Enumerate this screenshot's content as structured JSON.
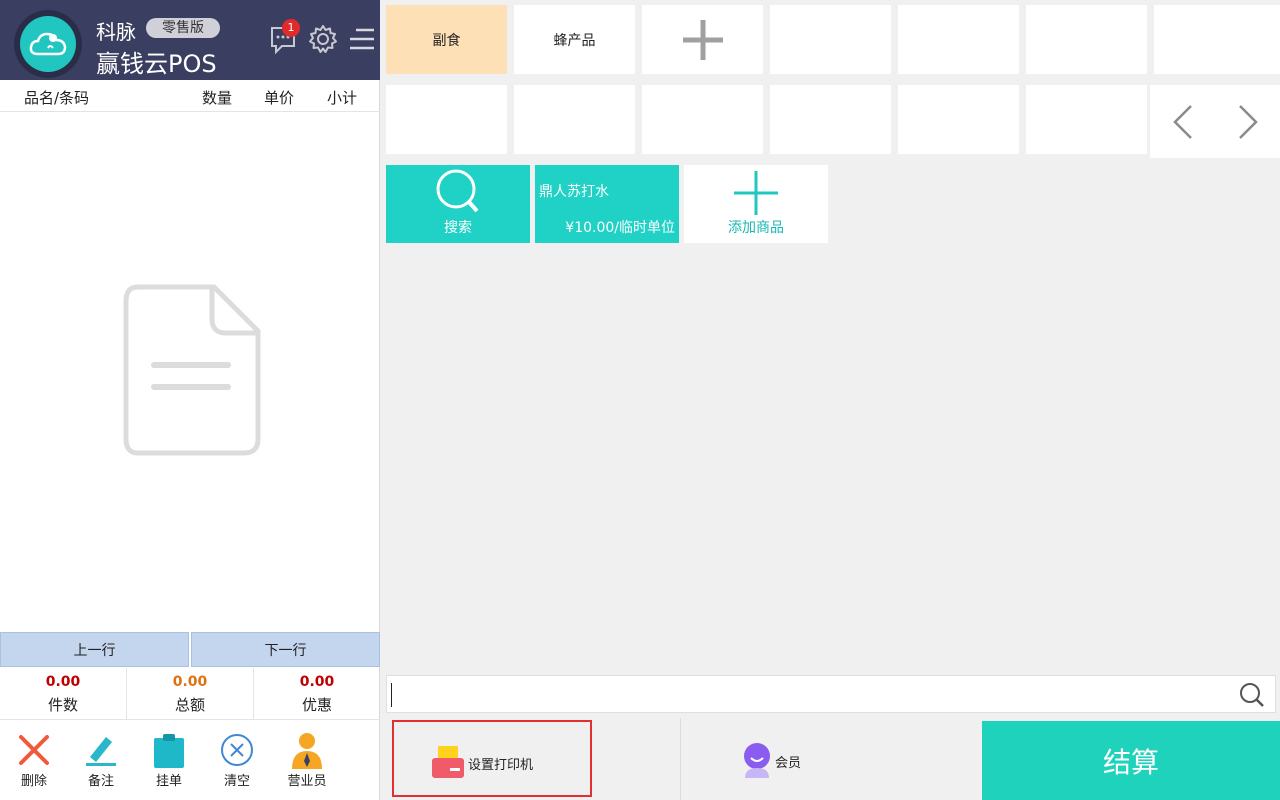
{
  "header": {
    "brand": "科脉",
    "edition_badge": "零售版",
    "app_title": "赢钱云POS",
    "notification_count": "1"
  },
  "order_table": {
    "columns": [
      "品名/条码",
      "数量",
      "单价",
      "小计"
    ]
  },
  "row_nav": {
    "prev": "上一行",
    "next": "下一行"
  },
  "totals": [
    {
      "value": "0.00",
      "label": "件数",
      "color": "#c00000"
    },
    {
      "value": "0.00",
      "label": "总额",
      "color": "#e07010"
    },
    {
      "value": "0.00",
      "label": "优惠",
      "color": "#c00000"
    }
  ],
  "tools": [
    {
      "label": "删除",
      "icon": "delete-x-icon"
    },
    {
      "label": "备注",
      "icon": "pen-icon"
    },
    {
      "label": "挂单",
      "icon": "clipboard-icon"
    },
    {
      "label": "清空",
      "icon": "clear-circle-icon"
    },
    {
      "label": "营业员",
      "icon": "salesperson-icon"
    }
  ],
  "categories": [
    {
      "label": "副食",
      "active": true
    },
    {
      "label": "蜂产品",
      "active": false
    }
  ],
  "products": {
    "search_label": "搜索",
    "item": {
      "name": "鼎人苏打水",
      "price": "¥10.00/临时单位"
    },
    "add_label": "添加商品"
  },
  "bottom": {
    "printer_label": "设置打印机",
    "member_label": "会员",
    "checkout_label": "结算"
  },
  "colors": {
    "header_bg": "#3a3e60",
    "accent_teal": "#1fd2c5",
    "active_category": "#fde0b6"
  }
}
